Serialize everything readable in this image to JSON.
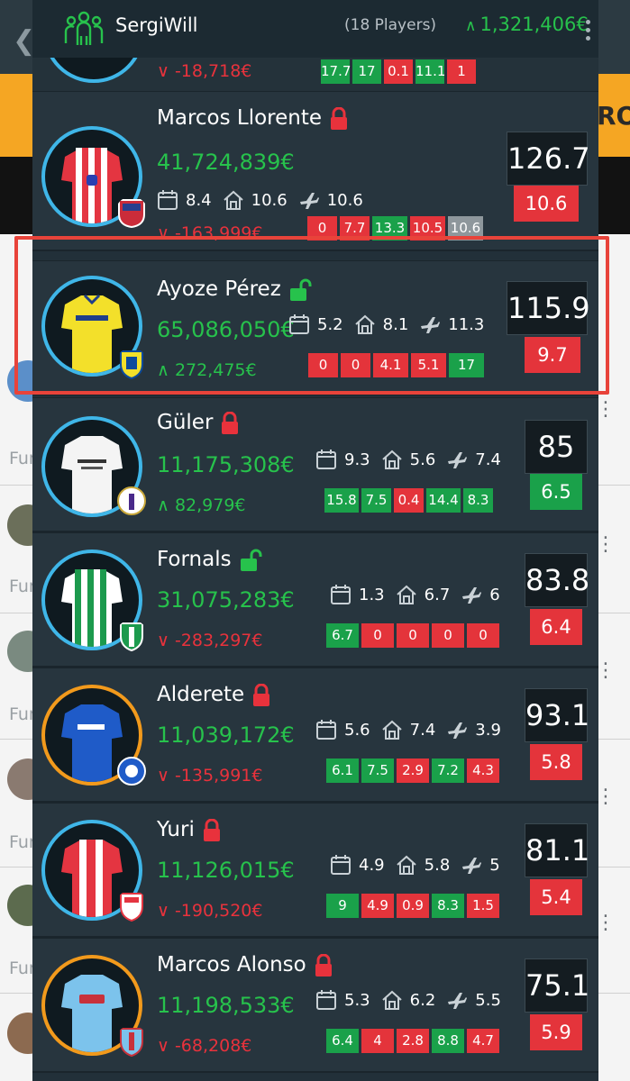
{
  "header": {
    "team_name": "SergiWill",
    "players_count": "(18 Players)",
    "team_value": "1,321,406€",
    "team_value_trend": "up"
  },
  "background": {
    "row_label": "Fur",
    "banner_text": "RO"
  },
  "colors": {
    "positive": "#27c24c",
    "negative": "#e8323c",
    "form_green": "#1aa14a",
    "form_red": "#e4343b",
    "highlight": "#e8433a",
    "avatar_ring_blue": "#3fb6e8",
    "avatar_ring_orange": "#f29a1c"
  },
  "players": [
    {
      "name": "",
      "value": "",
      "change": "-18,718€",
      "trend": "down",
      "stats": {
        "matchday": "",
        "home": "",
        "away": ""
      },
      "form": [
        "17.7",
        "17",
        "0.1",
        "11.1",
        "1"
      ],
      "form_colors": [
        "g",
        "g",
        "r",
        "g",
        "r"
      ],
      "points": "",
      "avg": ""
    },
    {
      "name": "Marcos Llorente",
      "locked": true,
      "club": "atletico",
      "value": "41,724,839€",
      "change": "-163,999€",
      "trend": "down",
      "stats": {
        "matchday": "8.4",
        "home": "10.6",
        "away": "10.6"
      },
      "form": [
        "0",
        "7.7",
        "13.3",
        "10.5",
        "10.6"
      ],
      "form_colors": [
        "r",
        "r",
        "g",
        "r",
        "gr"
      ],
      "points": "126.7",
      "avg": "10.6",
      "avg_color": "r"
    },
    {
      "name": "Ayoze Pérez",
      "locked": false,
      "club": "villarreal",
      "value": "65,086,050€",
      "change": "272,475€",
      "trend": "up",
      "stats": {
        "matchday": "5.2",
        "home": "8.1",
        "away": "11.3"
      },
      "form": [
        "0",
        "0",
        "4.1",
        "5.1",
        "17"
      ],
      "form_colors": [
        "r",
        "r",
        "r",
        "r",
        "g"
      ],
      "points": "115.9",
      "avg": "9.7",
      "avg_color": "r"
    },
    {
      "name": "Güler",
      "locked": true,
      "club": "real-madrid",
      "value": "11,175,308€",
      "change": "82,979€",
      "trend": "up",
      "stats": {
        "matchday": "9.3",
        "home": "5.6",
        "away": "7.4"
      },
      "form": [
        "15.8",
        "7.5",
        "0.4",
        "14.4",
        "8.3"
      ],
      "form_colors": [
        "g",
        "g",
        "r",
        "g",
        "g"
      ],
      "points": "85",
      "avg": "6.5",
      "avg_color": "g"
    },
    {
      "name": "Fornals",
      "locked": false,
      "club": "betis",
      "value": "31,075,283€",
      "change": "-283,297€",
      "trend": "down",
      "stats": {
        "matchday": "1.3",
        "home": "6.7",
        "away": "6"
      },
      "form": [
        "6.7",
        "0",
        "0",
        "0",
        "0"
      ],
      "form_colors": [
        "g",
        "r",
        "r",
        "r",
        "r"
      ],
      "points": "83.8",
      "avg": "6.4",
      "avg_color": "r"
    },
    {
      "name": "Alderete",
      "locked": true,
      "club": "getafe",
      "value": "11,039,172€",
      "change": "-135,991€",
      "trend": "down",
      "stats": {
        "matchday": "5.6",
        "home": "7.4",
        "away": "3.9"
      },
      "form": [
        "6.1",
        "7.5",
        "2.9",
        "7.2",
        "4.3"
      ],
      "form_colors": [
        "g",
        "g",
        "r",
        "g",
        "r"
      ],
      "points": "93.1",
      "avg": "5.8",
      "avg_color": "r"
    },
    {
      "name": "Yuri",
      "locked": true,
      "club": "athletic",
      "value": "11,126,015€",
      "change": "-190,520€",
      "trend": "down",
      "stats": {
        "matchday": "4.9",
        "home": "5.8",
        "away": "5"
      },
      "form": [
        "9",
        "4.9",
        "0.9",
        "8.3",
        "1.5"
      ],
      "form_colors": [
        "g",
        "r",
        "r",
        "g",
        "r"
      ],
      "points": "81.1",
      "avg": "5.4",
      "avg_color": "r"
    },
    {
      "name": "Marcos Alonso",
      "locked": true,
      "club": "celta",
      "value": "11,198,533€",
      "change": "-68,208€",
      "trend": "down",
      "stats": {
        "matchday": "5.3",
        "home": "6.2",
        "away": "5.5"
      },
      "form": [
        "6.4",
        "4",
        "2.8",
        "8.8",
        "4.7"
      ],
      "form_colors": [
        "g",
        "r",
        "r",
        "g",
        "r"
      ],
      "points": "75.1",
      "avg": "5.9",
      "avg_color": "r"
    }
  ]
}
